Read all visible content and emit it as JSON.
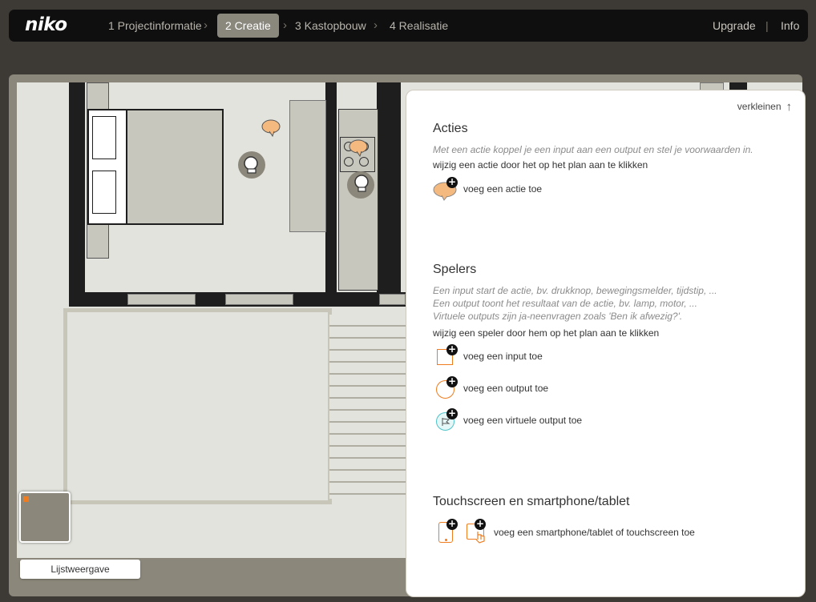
{
  "app": {
    "logo": "niko"
  },
  "steps": [
    {
      "label": "1 Projectinformatie",
      "active": false
    },
    {
      "label": "2 Creatie",
      "active": true
    },
    {
      "label": "3 Kastopbouw",
      "active": false
    },
    {
      "label": "4 Realisatie",
      "active": false
    }
  ],
  "nav_right": {
    "upgrade": "Upgrade",
    "separator": "|",
    "info": "Info"
  },
  "plan": {
    "list_view_button": "Lijstweergave"
  },
  "panel": {
    "collapse_label": "verkleinen",
    "actions": {
      "title": "Acties",
      "description": "Met een actie koppel je een input aan een output en stel je voorwaarden in.",
      "hint": "wijzig een actie door het op het plan aan te klikken",
      "add_label": "voeg een actie toe"
    },
    "players": {
      "title": "Spelers",
      "description_lines": [
        "Een input start de actie, bv. drukknop, bewegingsmelder, tijdstip, ...",
        "Een output toont het resultaat van de actie, bv. lamp, motor, ...",
        "Virtuele outputs zijn ja-neenvragen zoals 'Ben ik afwezig?'."
      ],
      "hint": "wijzig een speler door hem op het plan aan te klikken",
      "add_input": "voeg een input toe",
      "add_output": "voeg een output toe",
      "add_virtual_output": "voeg een virtuele output toe"
    },
    "touchscreen": {
      "title": "Touchscreen en smartphone/tablet",
      "add_label": "voeg een smartphone/tablet of touchscreen toe"
    }
  },
  "colors": {
    "accent": "#ef7d1f",
    "active_step": "#8a877c",
    "bubble": "#f4b97f",
    "virtual": "#4fc3c9"
  }
}
